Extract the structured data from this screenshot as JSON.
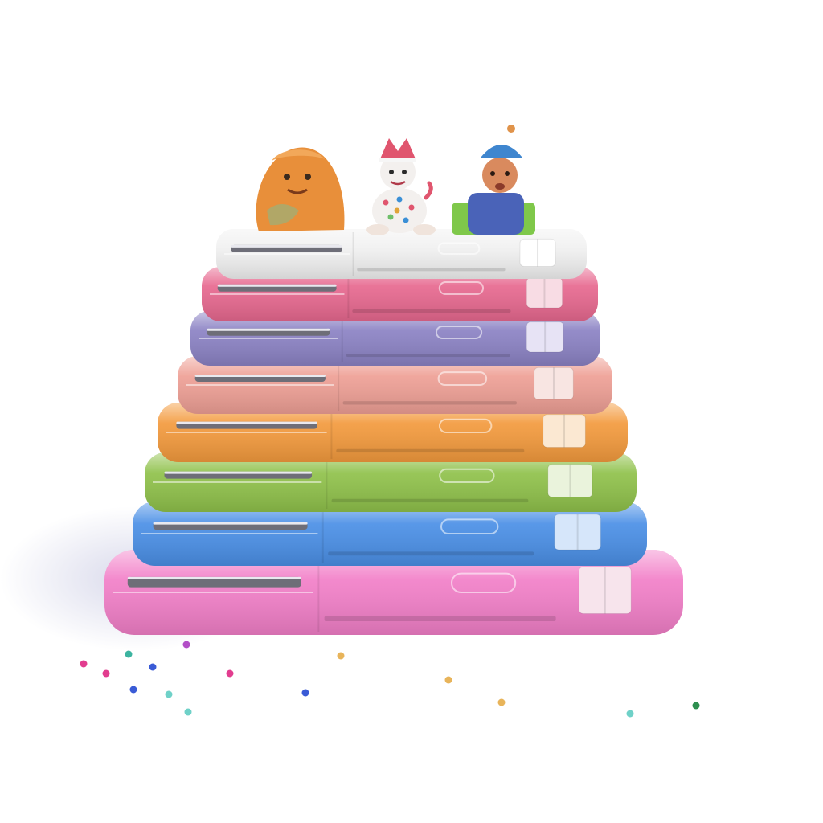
{
  "scene": {
    "background": "#ffffff",
    "shadow_color": "#d9d9e8",
    "cases": [
      {
        "name": "pink-large",
        "color": "#f27fc8",
        "cap": "#f7e4ec"
      },
      {
        "name": "blue",
        "color": "#4a8fe6",
        "cap": "#d6e6fa"
      },
      {
        "name": "green",
        "color": "#8fc14a",
        "cap": "#eaf3dc"
      },
      {
        "name": "orange",
        "color": "#f39a3d",
        "cap": "#fbe8d2"
      },
      {
        "name": "salmon",
        "color": "#ee9f95",
        "cap": "#f8e5e2"
      },
      {
        "name": "purple",
        "color": "#8b82c4",
        "cap": "#e7e3f5"
      },
      {
        "name": "rose",
        "color": "#e7688f",
        "cap": "#f8dce4"
      },
      {
        "name": "white",
        "color": "#f1f1f1",
        "cap": "#ffffff"
      }
    ],
    "figurines": [
      {
        "name": "orange-blob-figure",
        "color": "#e88f3a"
      },
      {
        "name": "snowman-figure",
        "color": "#f3f0ee"
      },
      {
        "name": "boy-figure",
        "color": "#d98a5e"
      }
    ],
    "confetti_colors": [
      "#e23d8f",
      "#3cb4a0",
      "#3a5bd6",
      "#6fd1c8",
      "#e8b45a",
      "#2d8f4f",
      "#b34fc7"
    ]
  }
}
